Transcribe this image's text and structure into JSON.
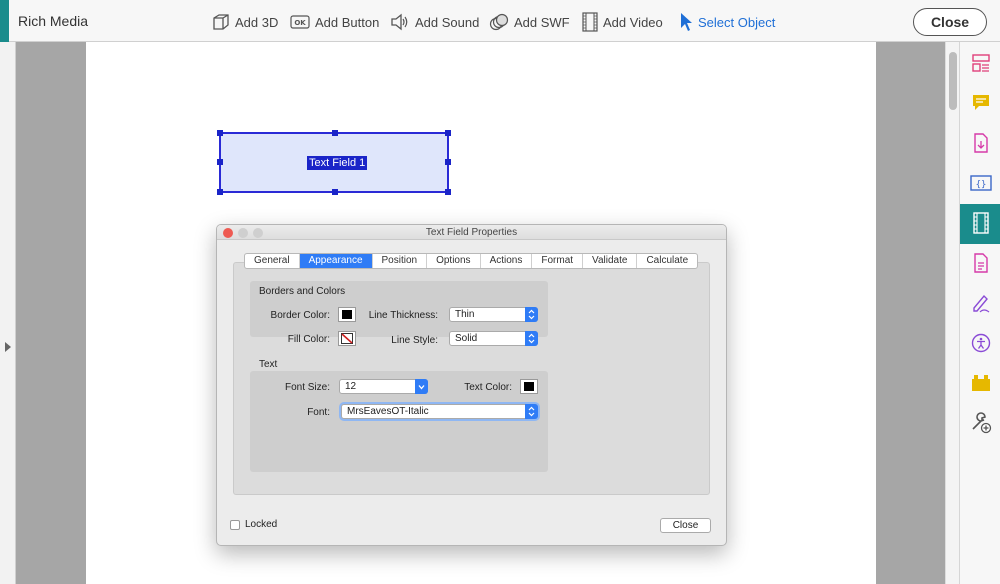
{
  "app": {
    "title": "Rich Media",
    "close_label": "Close",
    "accent_color": "#1a8c8c"
  },
  "toolbar": {
    "items": [
      {
        "label": "Add 3D",
        "icon": "cube-icon"
      },
      {
        "label": "Add Button",
        "icon": "ok-button-icon"
      },
      {
        "label": "Add Sound",
        "icon": "speaker-icon"
      },
      {
        "label": "Add SWF",
        "icon": "swf-icon"
      },
      {
        "label": "Add Video",
        "icon": "film-icon"
      },
      {
        "label": "Select Object",
        "icon": "cursor-icon",
        "active": true
      }
    ]
  },
  "document": {
    "field_label": "Text Field 1"
  },
  "right_panel": {
    "icons": [
      "organize-pages-icon",
      "comment-icon",
      "export-pdf-icon",
      "javascript-icon",
      "rich-media-icon",
      "create-pdf-icon",
      "fill-sign-icon",
      "accessibility-icon",
      "action-wizard-icon",
      "more-tools-icon"
    ],
    "active_icon": "rich-media-icon"
  },
  "dialog": {
    "title": "Text Field Properties",
    "tabs": [
      "General",
      "Appearance",
      "Position",
      "Options",
      "Actions",
      "Format",
      "Validate",
      "Calculate"
    ],
    "active_tab": "Appearance",
    "borders": {
      "heading": "Borders and Colors",
      "border_color_label": "Border Color:",
      "border_color": "#000000",
      "line_thickness_label": "Line Thickness:",
      "line_thickness": "Thin",
      "fill_color_label": "Fill Color:",
      "fill_color": "none",
      "line_style_label": "Line Style:",
      "line_style": "Solid"
    },
    "text": {
      "heading": "Text",
      "font_size_label": "Font Size:",
      "font_size": "12",
      "text_color_label": "Text Color:",
      "text_color": "#000000",
      "font_label": "Font:",
      "font": "MrsEavesOT-Italic"
    },
    "locked_label": "Locked",
    "close_label": "Close"
  }
}
